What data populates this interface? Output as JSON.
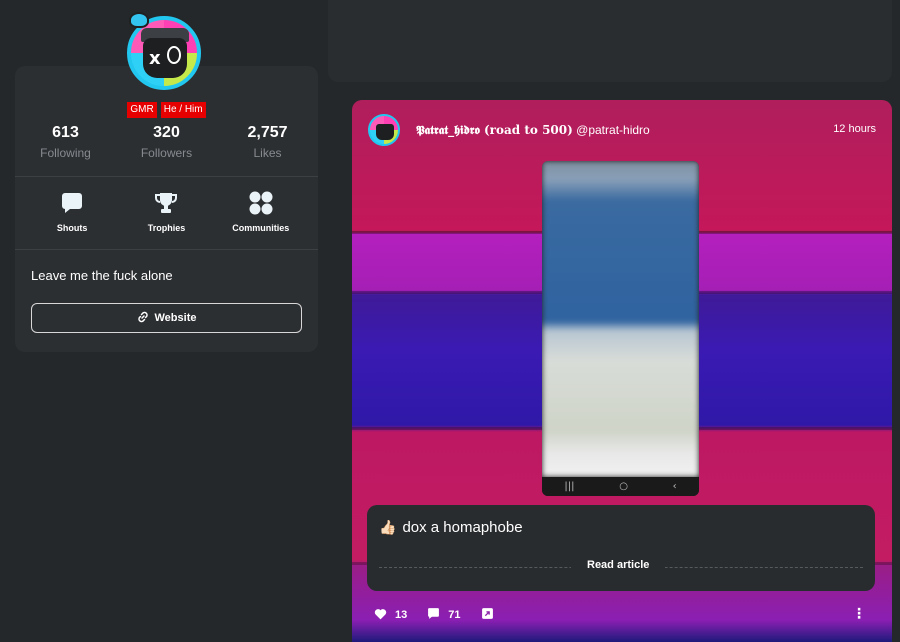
{
  "profile": {
    "tags": [
      "GMR",
      "He / Him"
    ],
    "stats": [
      {
        "value": "613",
        "label": "Following"
      },
      {
        "value": "320",
        "label": "Followers"
      },
      {
        "value": "2,757",
        "label": "Likes"
      }
    ],
    "quick_links": [
      {
        "label": "Shouts",
        "icon": "speech-bubble-icon"
      },
      {
        "label": "Trophies",
        "icon": "trophy-icon"
      },
      {
        "label": "Communities",
        "icon": "grid-circles-icon"
      }
    ],
    "bio": "Leave me the fuck alone",
    "website_label": "Website"
  },
  "post": {
    "author_name": "𝕻𝖆𝖙𝖗𝖆𝖙_𝖍𝖎𝖉𝖗𝖔 (road to 500)",
    "author_handle": "@patrat-hidro",
    "time": "12 hours",
    "article_emoji": "👍🏻",
    "article_title": "dox a homaphobe",
    "read_article_label": "Read article",
    "likes": "13",
    "comments": "71"
  },
  "colors": {
    "background": "#25282a",
    "card": "#2c2f32",
    "tag_red": "#e60000",
    "muted_text": "#878b90"
  }
}
